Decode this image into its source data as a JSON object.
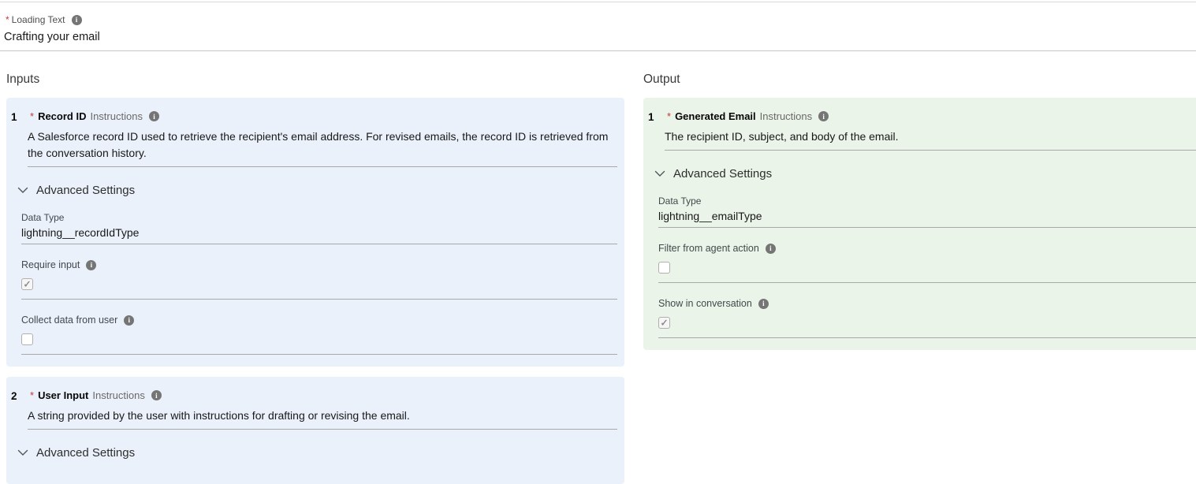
{
  "marks": {
    "required": "*"
  },
  "icons": {
    "info": "i",
    "chevron": "chevron-down"
  },
  "colors": {
    "input_card_bg": "#eaf1fb",
    "output_card_bg": "#eaf4e8",
    "required_red": "#c23934",
    "info_icon_gray": "#757575",
    "field_underline": "#a9a9a9"
  },
  "loading_field": {
    "label": "Loading Text",
    "value": "Crafting your email"
  },
  "inputs": {
    "title": "Inputs",
    "items": [
      {
        "index": "1",
        "name": "Record ID",
        "type_label": "Instructions",
        "description": "A Salesforce record ID used to retrieve the recipient's email address. For revised emails, the record ID is retrieved from the conversation history.",
        "advanced_label": "Advanced Settings",
        "data_type": {
          "label": "Data Type",
          "value": "lightning__recordIdType"
        },
        "checkboxes": [
          {
            "label": "Require input",
            "checked": true
          },
          {
            "label": "Collect data from user",
            "checked": false
          }
        ]
      },
      {
        "index": "2",
        "name": "User Input",
        "type_label": "Instructions",
        "description": "A string provided by the user with instructions for drafting or revising the email.",
        "advanced_label": "Advanced Settings"
      }
    ]
  },
  "output": {
    "title": "Output",
    "items": [
      {
        "index": "1",
        "name": "Generated Email",
        "type_label": "Instructions",
        "description": "The recipient ID, subject, and body of the email.",
        "advanced_label": "Advanced Settings",
        "data_type": {
          "label": "Data Type",
          "value": "lightning__emailType"
        },
        "checkboxes": [
          {
            "label": "Filter from agent action",
            "checked": false
          },
          {
            "label": "Show in conversation",
            "checked": true
          }
        ]
      }
    ]
  }
}
